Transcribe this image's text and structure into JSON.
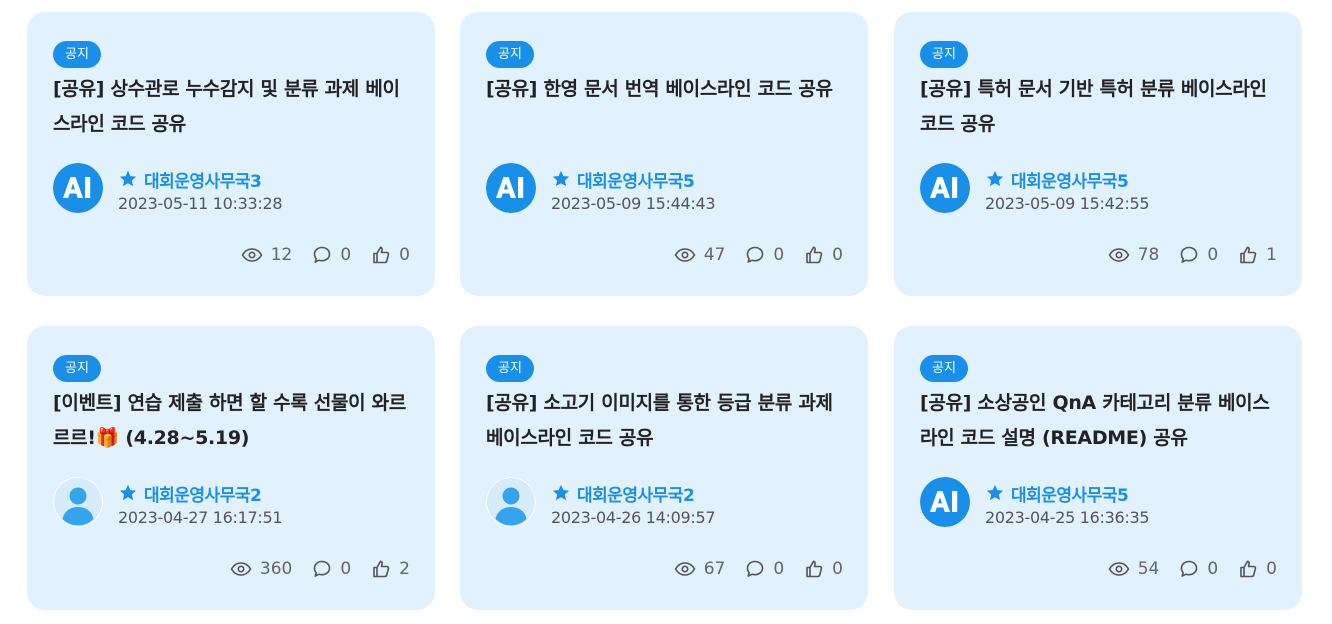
{
  "colors": {
    "accent": "#1890ea",
    "card_bg": "#e1f1fd",
    "text": "#222222",
    "muted": "#666666"
  },
  "cards": [
    {
      "badge": "공지",
      "title": "[공유] 상수관로 누수감지 및 분류 과제 베이스라인 코드 공유",
      "avatar_icon": "ai-logo-icon",
      "author": "대회운영사무국3",
      "date": "2023-05-11 10:33:28",
      "views": "12",
      "comments": "0",
      "likes": "0"
    },
    {
      "badge": "공지",
      "title": "[공유] 한영 문서 번역 베이스라인 코드 공유",
      "avatar_icon": "ai-logo-icon",
      "author": "대회운영사무국5",
      "date": "2023-05-09 15:44:43",
      "views": "47",
      "comments": "0",
      "likes": "0"
    },
    {
      "badge": "공지",
      "title": "[공유] 특허 문서 기반 특허 분류 베이스라인 코드 공유",
      "avatar_icon": "ai-logo-icon",
      "author": "대회운영사무국5",
      "date": "2023-05-09 15:42:55",
      "views": "78",
      "comments": "0",
      "likes": "1"
    },
    {
      "badge": "공지",
      "title": "[이벤트] 연습 제출 하면 할 수록 선물이 와르르르!🎁 (4.28~5.19)",
      "avatar_icon": "user-avatar-icon",
      "author": "대회운영사무국2",
      "date": "2023-04-27 16:17:51",
      "views": "360",
      "comments": "0",
      "likes": "2"
    },
    {
      "badge": "공지",
      "title": "[공유] 소고기 이미지를 통한 등급 분류 과제 베이스라인 코드 공유",
      "avatar_icon": "user-avatar-icon",
      "author": "대회운영사무국2",
      "date": "2023-04-26 14:09:57",
      "views": "67",
      "comments": "0",
      "likes": "0"
    },
    {
      "badge": "공지",
      "title": "[공유] 소상공인 QnA 카테고리 분류 베이스라인 코드 설명 (README) 공유",
      "avatar_icon": "ai-logo-icon",
      "author": "대회운영사무국5",
      "date": "2023-04-25 16:36:35",
      "views": "54",
      "comments": "0",
      "likes": "0"
    }
  ],
  "icons": {
    "star": "star-icon",
    "views": "eye-icon",
    "comments": "comment-icon",
    "likes": "thumbs-up-icon"
  }
}
